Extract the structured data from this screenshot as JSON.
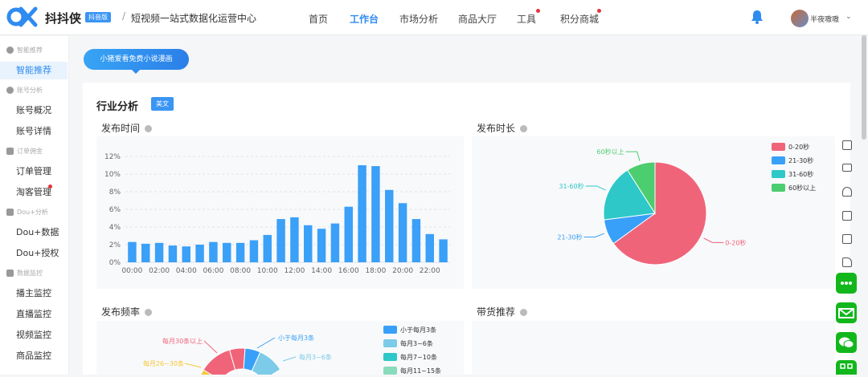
{
  "header": {
    "brand": "抖抖侠",
    "badge": "抖音版",
    "separator": "/",
    "slogan": "短视频一站式数据化运营中心",
    "nav": [
      "首页",
      "工作台",
      "市场分析",
      "商品大厅",
      "工具",
      "积分商城"
    ],
    "active_nav": "工作台",
    "username": "半夜嗷嗷"
  },
  "sidebar": {
    "groups": [
      {
        "label": "智能推荐",
        "items": [
          "智能推荐"
        ]
      },
      {
        "label": "账号分析",
        "items": [
          "账号概况",
          "账号详情"
        ]
      },
      {
        "label": "订单佣金",
        "items": [
          "订单管理",
          "淘客管理"
        ]
      },
      {
        "label": "Dou+分析",
        "items": [
          "Dou+数据",
          "Dou+授权"
        ]
      },
      {
        "label": "数据监控",
        "items": [
          "播主监控",
          "直播监控",
          "视频监控",
          "商品监控"
        ]
      }
    ],
    "active": "智能推荐"
  },
  "main": {
    "tab": "小猪爱看免费小说漫画",
    "section_title": "行业分析",
    "lang_button": "美文",
    "panels": {
      "time": "发布时间",
      "duration": "发布时长",
      "frequency": "发布频率",
      "goods": "带货推荐"
    }
  },
  "chart_data": [
    {
      "type": "bar",
      "title": "发布时间",
      "categories": [
        "00:00",
        "01:00",
        "02:00",
        "03:00",
        "04:00",
        "05:00",
        "06:00",
        "07:00",
        "08:00",
        "09:00",
        "10:00",
        "11:00",
        "12:00",
        "13:00",
        "14:00",
        "15:00",
        "16:00",
        "17:00",
        "18:00",
        "19:00",
        "20:00",
        "21:00",
        "22:00",
        "23:00"
      ],
      "tick_labels": [
        "00:00",
        "02:00",
        "04:00",
        "06:00",
        "08:00",
        "10:00",
        "12:00",
        "14:00",
        "16:00",
        "18:00",
        "20:00",
        "22:00"
      ],
      "values": [
        2.3,
        2.1,
        2.2,
        1.9,
        1.8,
        2.0,
        2.3,
        2.2,
        2.2,
        2.5,
        3.1,
        4.9,
        5.1,
        4.2,
        3.8,
        4.4,
        6.3,
        11.0,
        10.9,
        8.2,
        6.7,
        4.9,
        3.2,
        2.6
      ],
      "yticks": [
        "0%",
        "2%",
        "4%",
        "6%",
        "8%",
        "10%",
        "12%"
      ],
      "ylim": [
        0,
        12
      ],
      "color": "#3aa0f8"
    },
    {
      "type": "pie",
      "title": "发布时长",
      "labels": [
        "0-20秒",
        "21-30秒",
        "31-60秒",
        "60秒以上"
      ],
      "values": [
        65,
        8,
        18,
        9
      ],
      "colors": [
        "#f0647a",
        "#38a0f8",
        "#2ec8c8",
        "#4ccd6f"
      ]
    },
    {
      "type": "pie",
      "title": "发布频率",
      "legend": [
        "小于每月3条",
        "每月3~6条",
        "每月7~10条",
        "每月11~15条"
      ],
      "slice_labels": [
        "每月30条以上",
        "小于每月3条",
        "每月3~6条",
        "每月26~30条"
      ],
      "colors": [
        "#38a0f8",
        "#7ccbe8",
        "#2ec8c8",
        "#88dbbb"
      ]
    }
  ]
}
